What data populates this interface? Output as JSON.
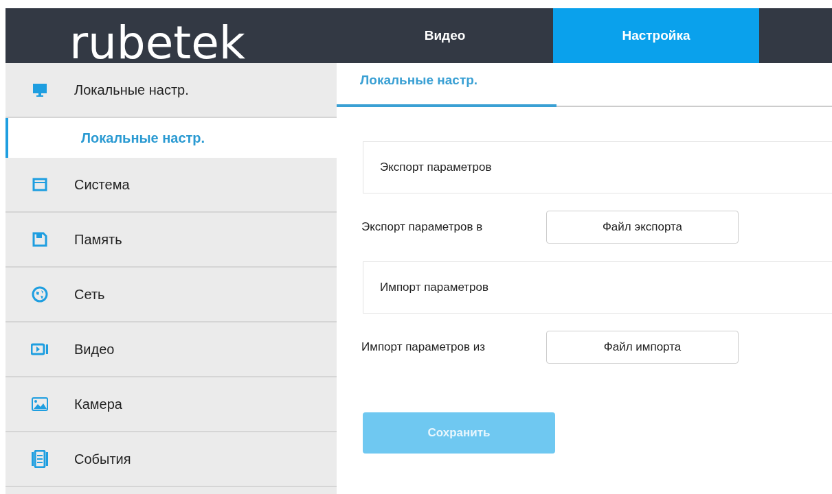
{
  "header": {
    "logo": "rubetek",
    "tabs": [
      {
        "label": "Видео",
        "selected": false
      },
      {
        "label": "Настройка",
        "selected": true
      }
    ]
  },
  "sidebar": {
    "items": [
      {
        "label": "Локальные настр.",
        "children": [
          {
            "label": "Локальные настр.",
            "selected": true
          }
        ]
      },
      {
        "label": "Система"
      },
      {
        "label": "Память"
      },
      {
        "label": "Сеть"
      },
      {
        "label": "Видео"
      },
      {
        "label": "Камера"
      },
      {
        "label": "События"
      }
    ]
  },
  "subtabs": [
    {
      "label": "Локальные настр.",
      "selected": true
    }
  ],
  "sections": [
    {
      "title": "Экспорт параметров",
      "row_label": "Экспорт параметров в",
      "button": "Файл экспорта"
    },
    {
      "title": "Импорт параметров",
      "row_label": "Импорт параметров из",
      "button": "Файл импорта"
    }
  ],
  "save_button": {
    "label": "Сохранить",
    "disabled": true
  }
}
